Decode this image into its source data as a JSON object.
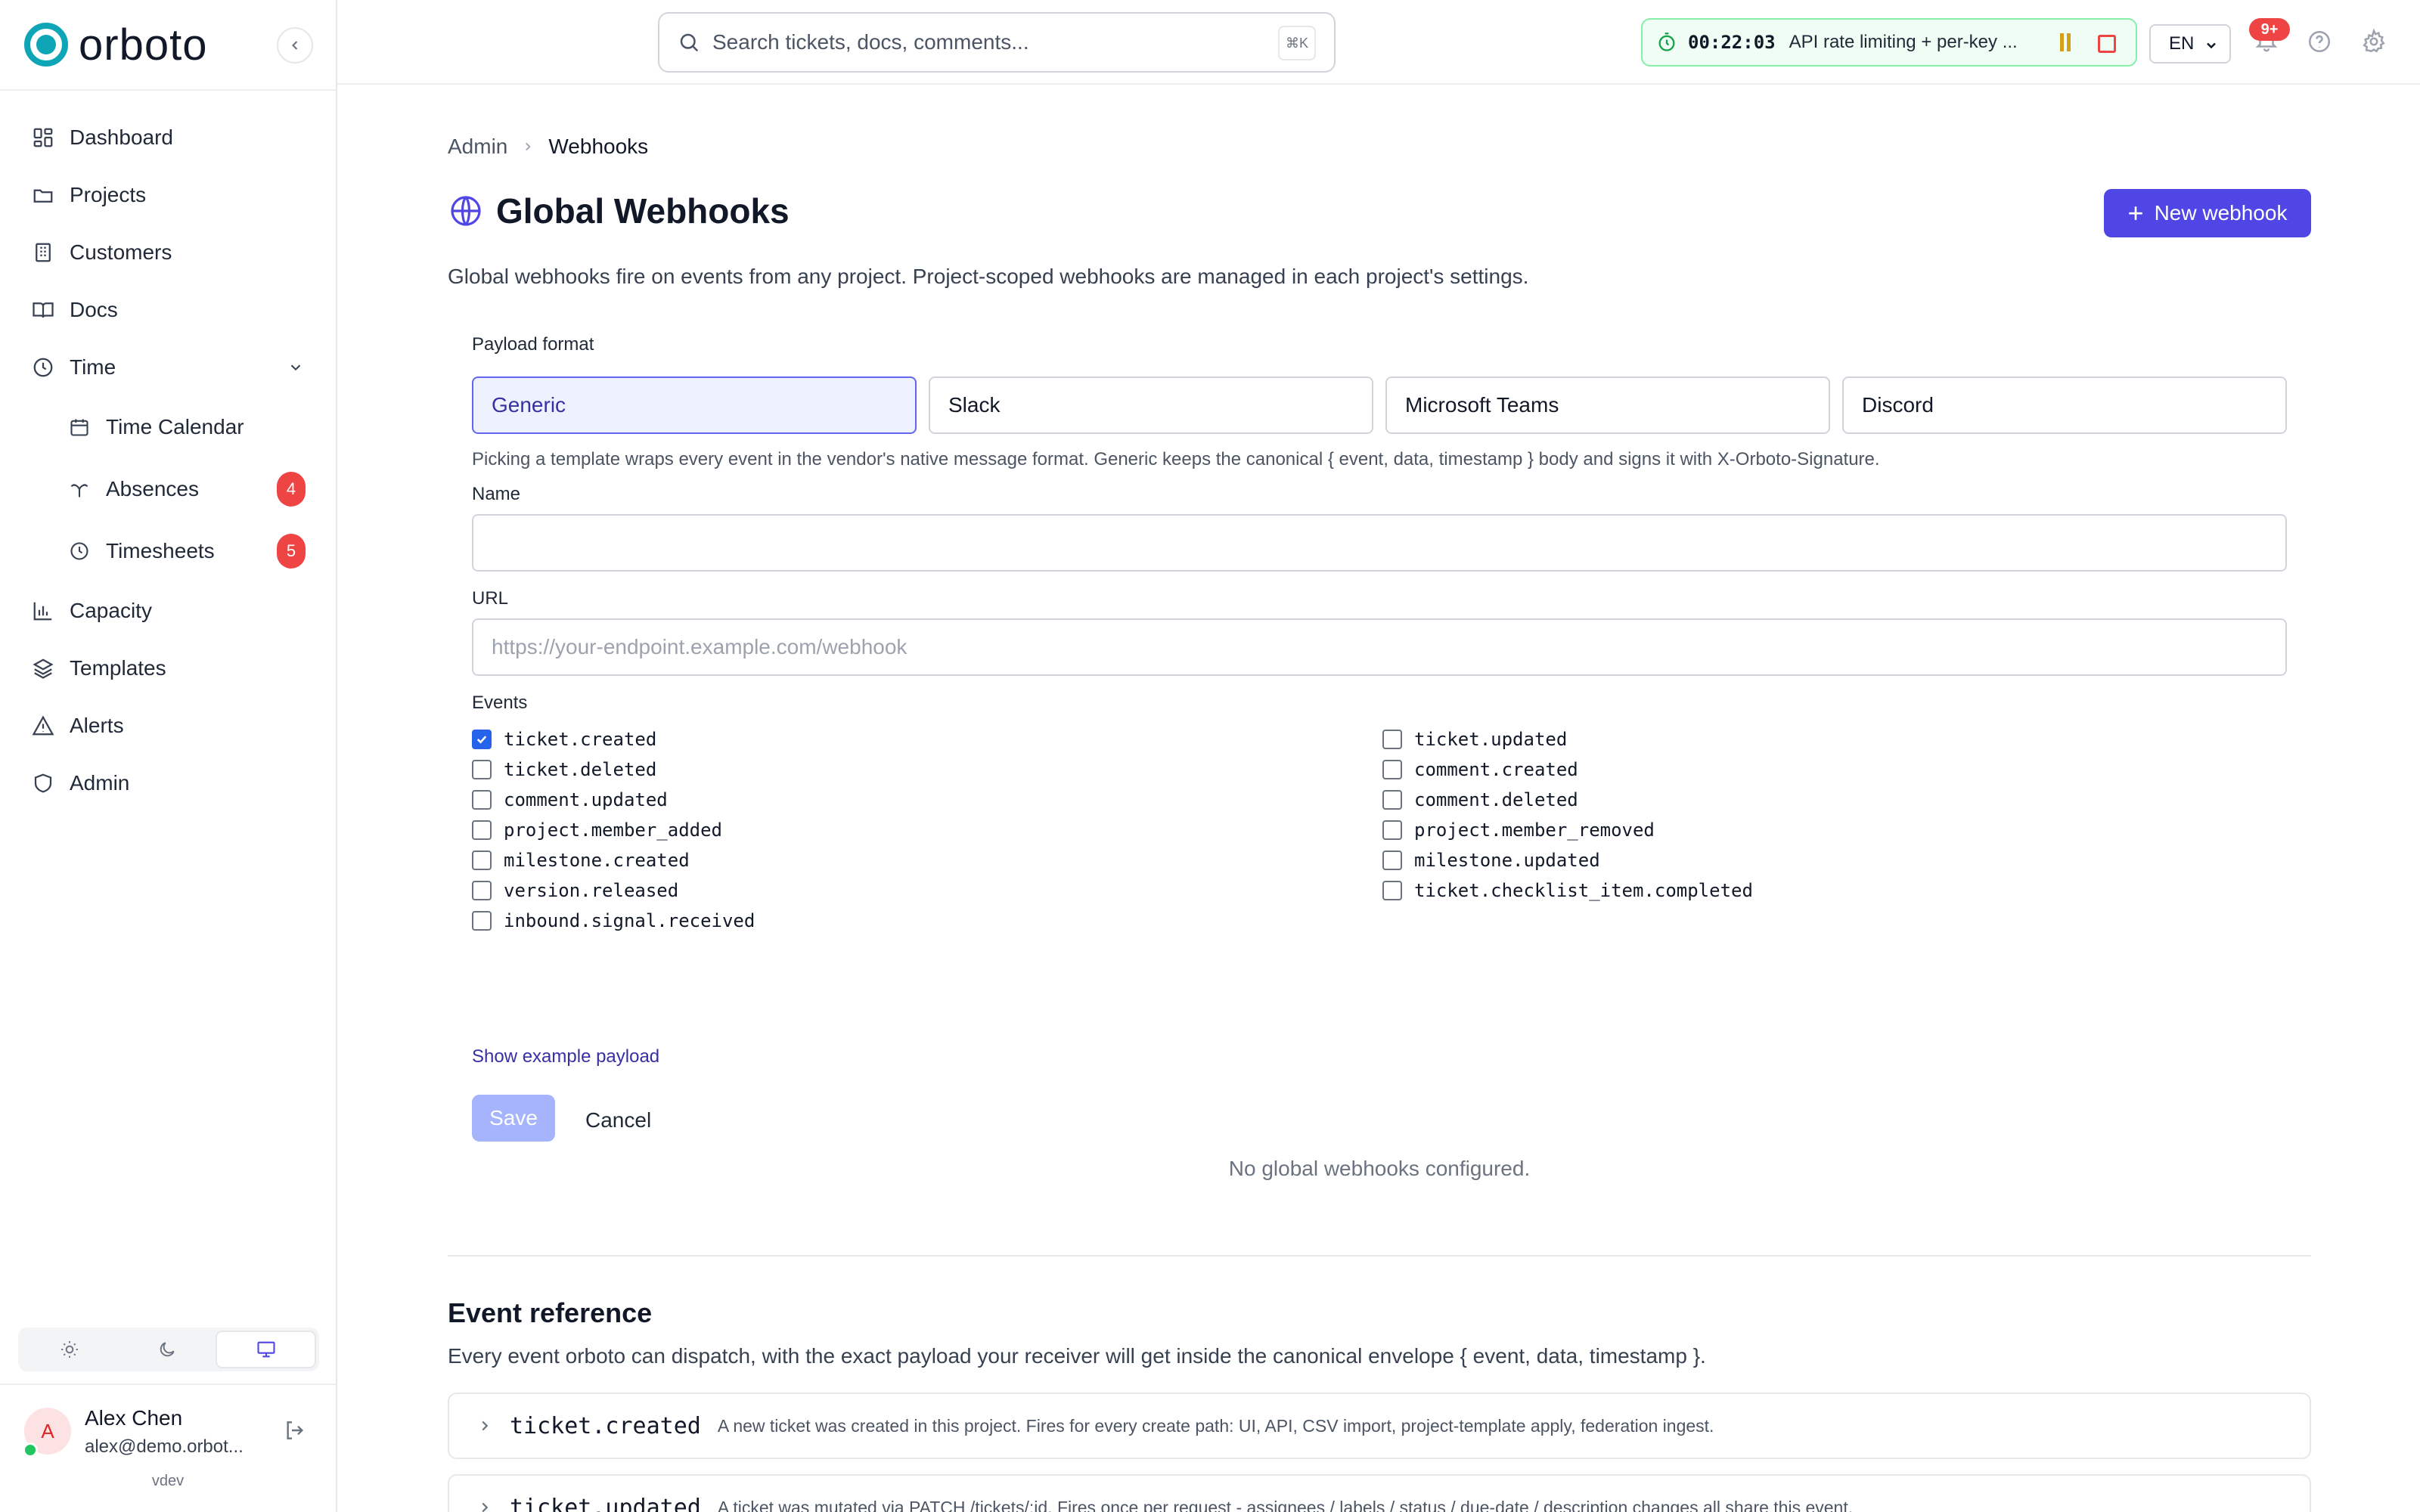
{
  "app": {
    "logo_text": "orboto"
  },
  "sidebar": {
    "items": [
      {
        "label": "Dashboard"
      },
      {
        "label": "Projects"
      },
      {
        "label": "Customers"
      },
      {
        "label": "Docs"
      },
      {
        "label": "Time"
      },
      {
        "label": "Time Calendar"
      },
      {
        "label": "Absences",
        "badge": "4"
      },
      {
        "label": "Timesheets",
        "badge": "5"
      },
      {
        "label": "Capacity"
      },
      {
        "label": "Templates"
      },
      {
        "label": "Alerts"
      },
      {
        "label": "Admin"
      }
    ],
    "user": {
      "initial": "A",
      "name": "Alex Chen",
      "email": "alex@demo.orbot...",
      "env": "vdev"
    }
  },
  "topbar": {
    "search_placeholder": "Search tickets, docs, comments...",
    "search_shortcut": "⌘K",
    "timer": {
      "elapsed": "00:22:03",
      "task": "API rate limiting + per-key ..."
    },
    "language": "EN",
    "notifications_badge": "9+"
  },
  "breadcrumb": {
    "parent": "Admin",
    "current": "Webhooks"
  },
  "page": {
    "title": "Global Webhooks",
    "new_button": "New webhook",
    "description": "Global webhooks fire on events from any project. Project-scoped webhooks are managed in each project's settings."
  },
  "form": {
    "payload_label": "Payload format",
    "formats": [
      "Generic",
      "Slack",
      "Microsoft Teams",
      "Discord"
    ],
    "selected_format": "Generic",
    "format_hint": "Picking a template wraps every event in the vendor's native message format. Generic keeps the canonical { event, data, timestamp } body and signs it with X-Orboto-Signature.",
    "name_label": "Name",
    "name_value": "",
    "url_label": "URL",
    "url_placeholder": "https://your-endpoint.example.com/webhook",
    "events_label": "Events",
    "events_left": [
      {
        "name": "ticket.created",
        "checked": true
      },
      {
        "name": "ticket.deleted",
        "checked": false
      },
      {
        "name": "comment.updated",
        "checked": false
      },
      {
        "name": "project.member_added",
        "checked": false
      },
      {
        "name": "milestone.created",
        "checked": false
      },
      {
        "name": "version.released",
        "checked": false
      },
      {
        "name": "inbound.signal.received",
        "checked": false
      }
    ],
    "events_right": [
      {
        "name": "ticket.updated",
        "checked": false
      },
      {
        "name": "comment.created",
        "checked": false
      },
      {
        "name": "comment.deleted",
        "checked": false
      },
      {
        "name": "project.member_removed",
        "checked": false
      },
      {
        "name": "milestone.updated",
        "checked": false
      },
      {
        "name": "ticket.checklist_item.completed",
        "checked": false
      }
    ],
    "example_link": "Show example payload",
    "save_label": "Save",
    "cancel_label": "Cancel"
  },
  "empty_state": "No global webhooks configured.",
  "reference": {
    "title": "Event reference",
    "description": "Every event orboto can dispatch, with the exact payload your receiver will get inside the canonical envelope { event, data, timestamp }.",
    "rows": [
      {
        "name": "ticket.created",
        "description": "A new ticket was created in this project. Fires for every create path: UI, API, CSV import, project-template apply, federation ingest."
      },
      {
        "name": "ticket.updated",
        "description": "A ticket was mutated via PATCH /tickets/:id. Fires once per request - assignees / labels / status / due-date / description changes all share this event."
      }
    ]
  },
  "colors": {
    "accent": "#4f46e5",
    "brand": "#0ea5b7",
    "badge": "#ef4444"
  }
}
